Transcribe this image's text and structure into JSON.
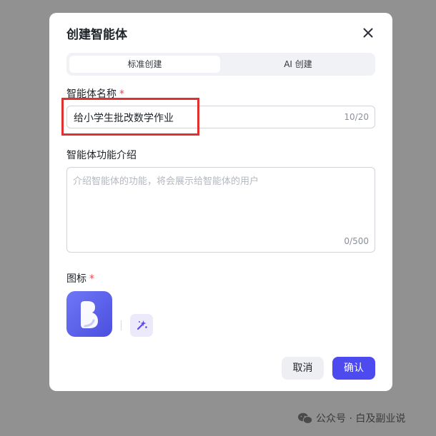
{
  "dialog": {
    "title": "创建智能体",
    "tabs": [
      {
        "label": "标准创建",
        "active": true
      },
      {
        "label": "AI 创建",
        "active": false
      }
    ],
    "name_field": {
      "label": "智能体名称",
      "required_mark": "*",
      "value": "给小学生批改数学作业",
      "counter": "10/20"
    },
    "desc_field": {
      "label": "智能体功能介绍",
      "placeholder": "介绍智能体的功能，将会展示给智能体的用户",
      "counter": "0/500"
    },
    "icon_field": {
      "label": "图标",
      "required_mark": "*"
    },
    "buttons": {
      "cancel": "取消",
      "confirm": "确认"
    }
  },
  "watermark": {
    "text": "公众号 · 白及副业说"
  },
  "colors": {
    "overlay": "#919191",
    "primary": "#4d4aef",
    "required": "#e5484d",
    "highlight": "#e03131"
  },
  "icons": [
    "close-icon",
    "app-icon",
    "sparkle-icon",
    "wechat-icon"
  ]
}
